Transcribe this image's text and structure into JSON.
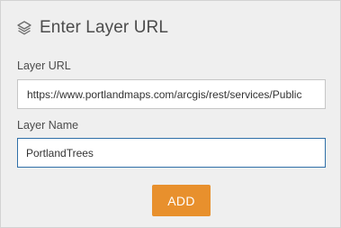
{
  "header": {
    "title": "Enter Layer URL",
    "icon": "layers-icon"
  },
  "form": {
    "url_label": "Layer URL",
    "url_value": "https://www.portlandmaps.com/arcgis/rest/services/Public",
    "name_label": "Layer Name",
    "name_value": "PortlandTrees"
  },
  "actions": {
    "add_label": "ADD"
  },
  "colors": {
    "accent": "#e8902d",
    "focus_border": "#2f6fa8",
    "panel_bg": "#efefef"
  }
}
